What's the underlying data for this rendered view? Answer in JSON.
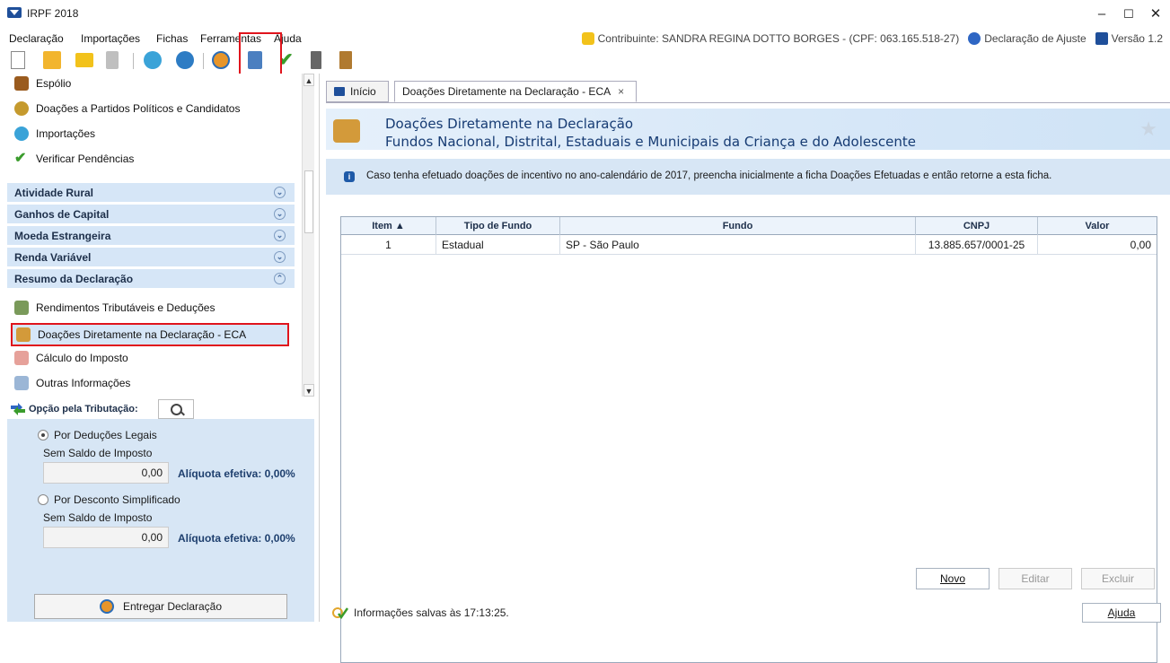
{
  "window": {
    "title": "IRPF 2018",
    "minimize": "–",
    "maximize": "☐",
    "close": "✕"
  },
  "menubar": {
    "items": [
      "Declaração",
      "Importações",
      "Fichas",
      "Ferramentas",
      "Ajuda"
    ],
    "contribuinte": "Contribuinte: SANDRA REGINA DOTTO BORGES - (CPF: 063.165.518-27)",
    "declaracao": "Declaração de Ajuste",
    "versao": "Versão 1.2"
  },
  "toolbar": {
    "icons": [
      "new-document-icon",
      "open-folder-icon",
      "folder-icon",
      "trash-icon",
      "import-icon",
      "receita-icon",
      "globe-icon",
      "print-icon",
      "check-icon",
      "calculator-icon",
      "book-icon"
    ]
  },
  "sidebar": {
    "top_items": [
      {
        "label": "Espólio",
        "icon": "chest-icon"
      },
      {
        "label": "Doações a Partidos Políticos e Candidatos",
        "icon": "person-icon"
      },
      {
        "label": "Importações",
        "icon": "import-icon"
      },
      {
        "label": "Verificar Pendências",
        "icon": "check-icon"
      }
    ],
    "sections": [
      {
        "label": "Atividade Rural",
        "state": "collapsed"
      },
      {
        "label": "Ganhos de Capital",
        "state": "collapsed"
      },
      {
        "label": "Moeda Estrangeira",
        "state": "collapsed"
      },
      {
        "label": "Renda Variável",
        "state": "collapsed"
      },
      {
        "label": "Resumo da Declaração",
        "state": "expanded"
      }
    ],
    "resumo_items": [
      {
        "label": "Rendimentos Tributáveis e Deduções",
        "icon": "money-icon"
      },
      {
        "label": "Doações Diretamente na Declaração - ECA",
        "icon": "donation-icon",
        "selected": true
      },
      {
        "label": "Cálculo do Imposto",
        "icon": "percent-icon"
      },
      {
        "label": "Outras Informações",
        "icon": "info-icon"
      }
    ]
  },
  "tax_option": {
    "title": "Opção pela Tributação:",
    "options": [
      {
        "label": "Por Deduções Legais",
        "selected": true,
        "saldo_label": "Sem Saldo de Imposto",
        "value": "0,00",
        "aliquota": "Alíquota efetiva: 0,00%"
      },
      {
        "label": "Por Desconto Simplificado",
        "selected": false,
        "saldo_label": "Sem Saldo de Imposto",
        "value": "0,00",
        "aliquota": "Alíquota efetiva: 0,00%"
      }
    ],
    "deliver_button": "Entregar Declaração"
  },
  "tabs": [
    {
      "label": "Início",
      "active": false
    },
    {
      "label": "Doações Diretamente na Declaração - ECA",
      "active": true,
      "close": "×"
    }
  ],
  "banner": {
    "title": "Doações Diretamente na Declaração",
    "subtitle": "Fundos Nacional, Distrital, Estaduais e Municipais da Criança e do Adolescente"
  },
  "info_message": "Caso tenha efetuado doações de incentivo no ano-calendário de 2017, preencha inicialmente a ficha Doações Efetuadas e então retorne a esta ficha.",
  "table": {
    "columns": [
      "Item ▲",
      "Tipo de Fundo",
      "Fundo",
      "CNPJ",
      "Valor"
    ],
    "rows": [
      [
        "1",
        "Estadual",
        "SP - São Paulo",
        "13.885.657/0001-25",
        "0,00"
      ]
    ]
  },
  "buttons": {
    "novo": "Novo",
    "editar": "Editar",
    "excluir": "Excluir",
    "ajuda": "Ajuda"
  },
  "status": "Informações salvas às 17:13:25."
}
